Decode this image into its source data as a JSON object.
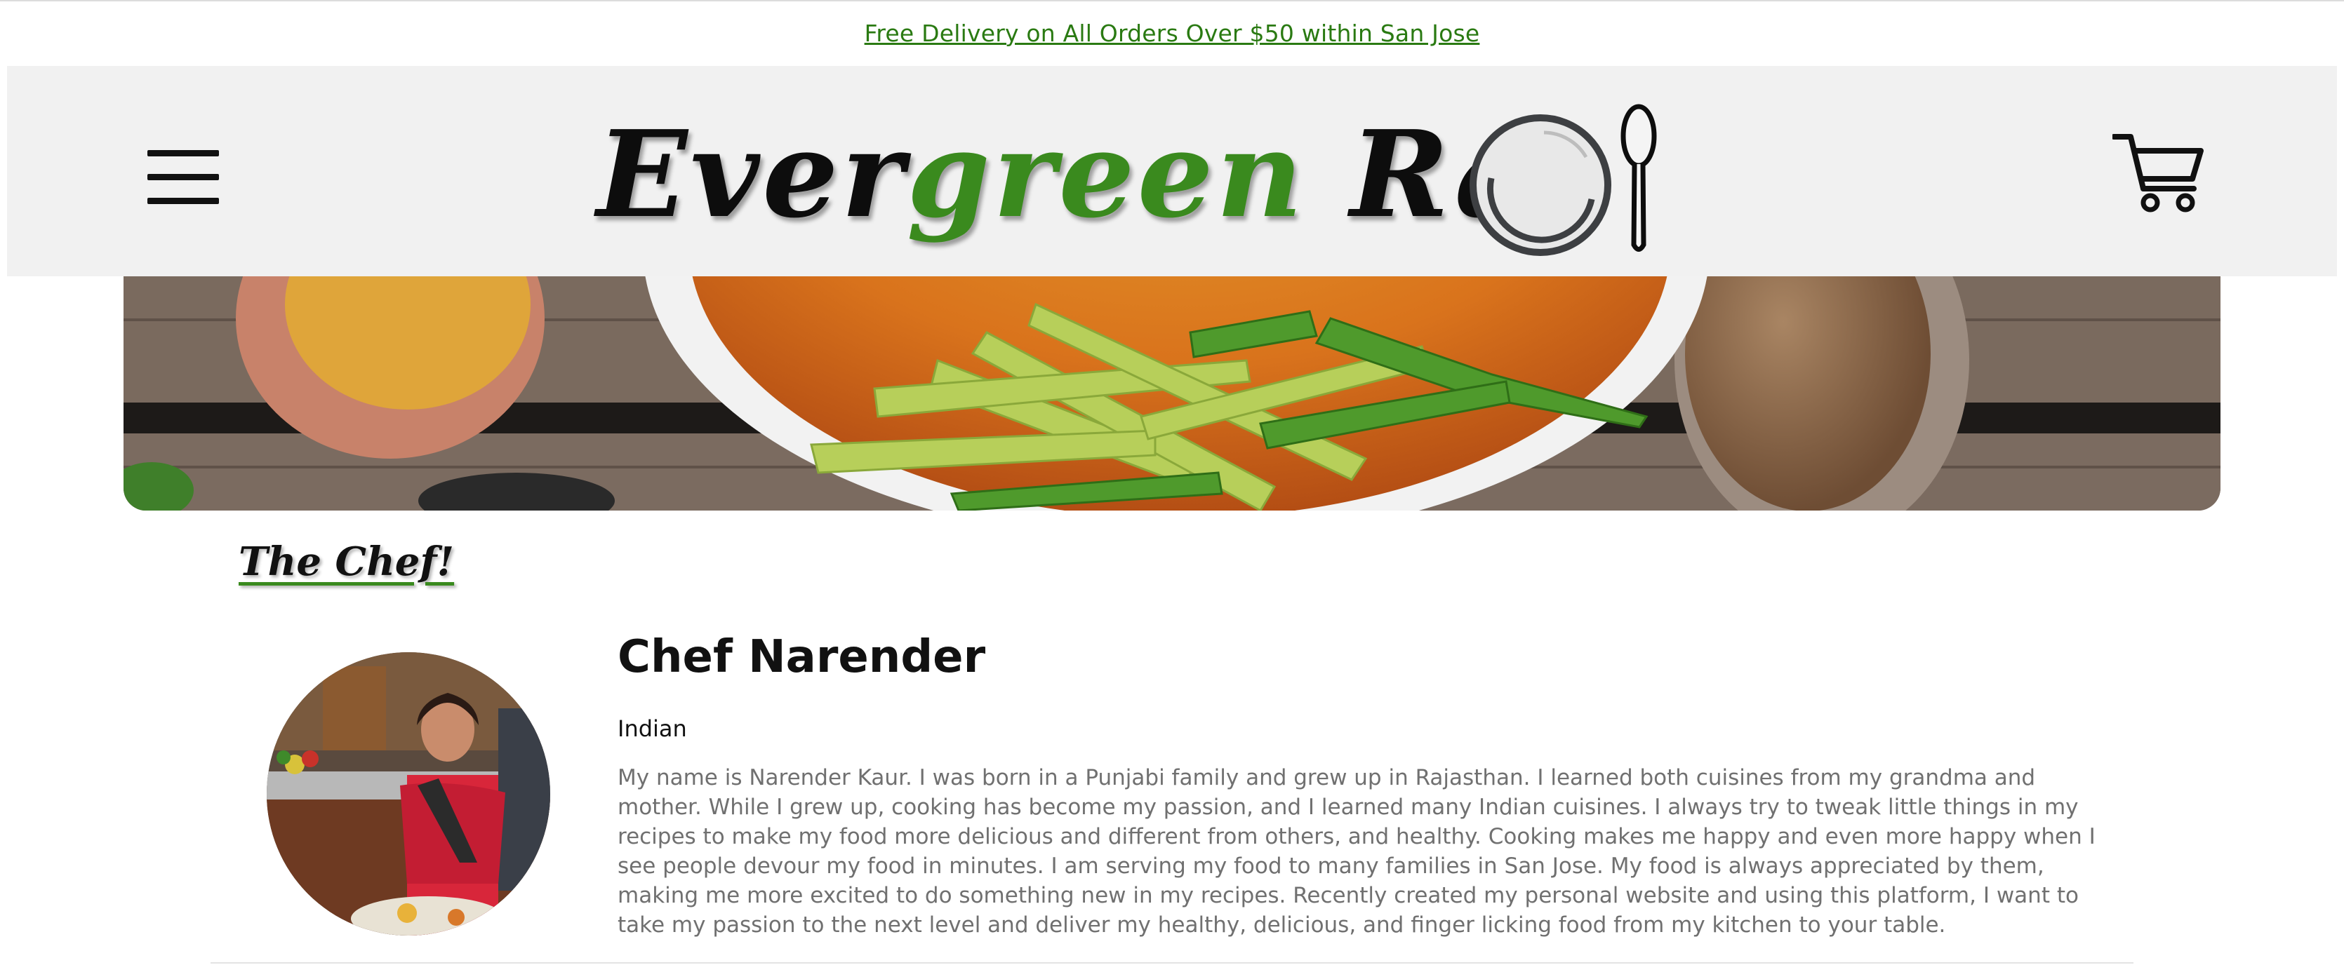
{
  "promo": {
    "text": "Free Delivery on All Orders Over $50 within San Jose"
  },
  "header": {
    "logo": {
      "word1": "Ever",
      "word2": "green",
      "word3": " Ras"
    },
    "menu_icon": "hamburger-menu-icon",
    "cart_icon": "shopping-cart-icon"
  },
  "hero": {
    "description": "curry dish with sliced ginger and green chilies on wooden table"
  },
  "section": {
    "title": "The Chef!"
  },
  "chef": {
    "name": "Chef Narender",
    "cuisine": "Indian",
    "bio": "My name is Narender Kaur. I was born in a Punjabi family and grew up in Rajasthan. I learned both cuisines from my grandma and mother. While I grew up, cooking has become my passion, and I learned many Indian cuisines. I always try to tweak little things in my recipes to make my food more delicious and different from others, and healthy. Cooking makes me happy and even more happy when I see people devour my food in minutes. I am serving my food to many families in San Jose. My food is always appreciated by them, making me more excited to do something new in my recipes. Recently created my personal website and using this platform, I want to take my passion to the next level and deliver my healthy, delicious, and finger licking food from my kitchen to your table."
  },
  "colors": {
    "brand_green": "#3a8a1e",
    "link_green": "#2a7a12",
    "header_bg": "#f1f1f1",
    "bio_text": "#707070"
  }
}
